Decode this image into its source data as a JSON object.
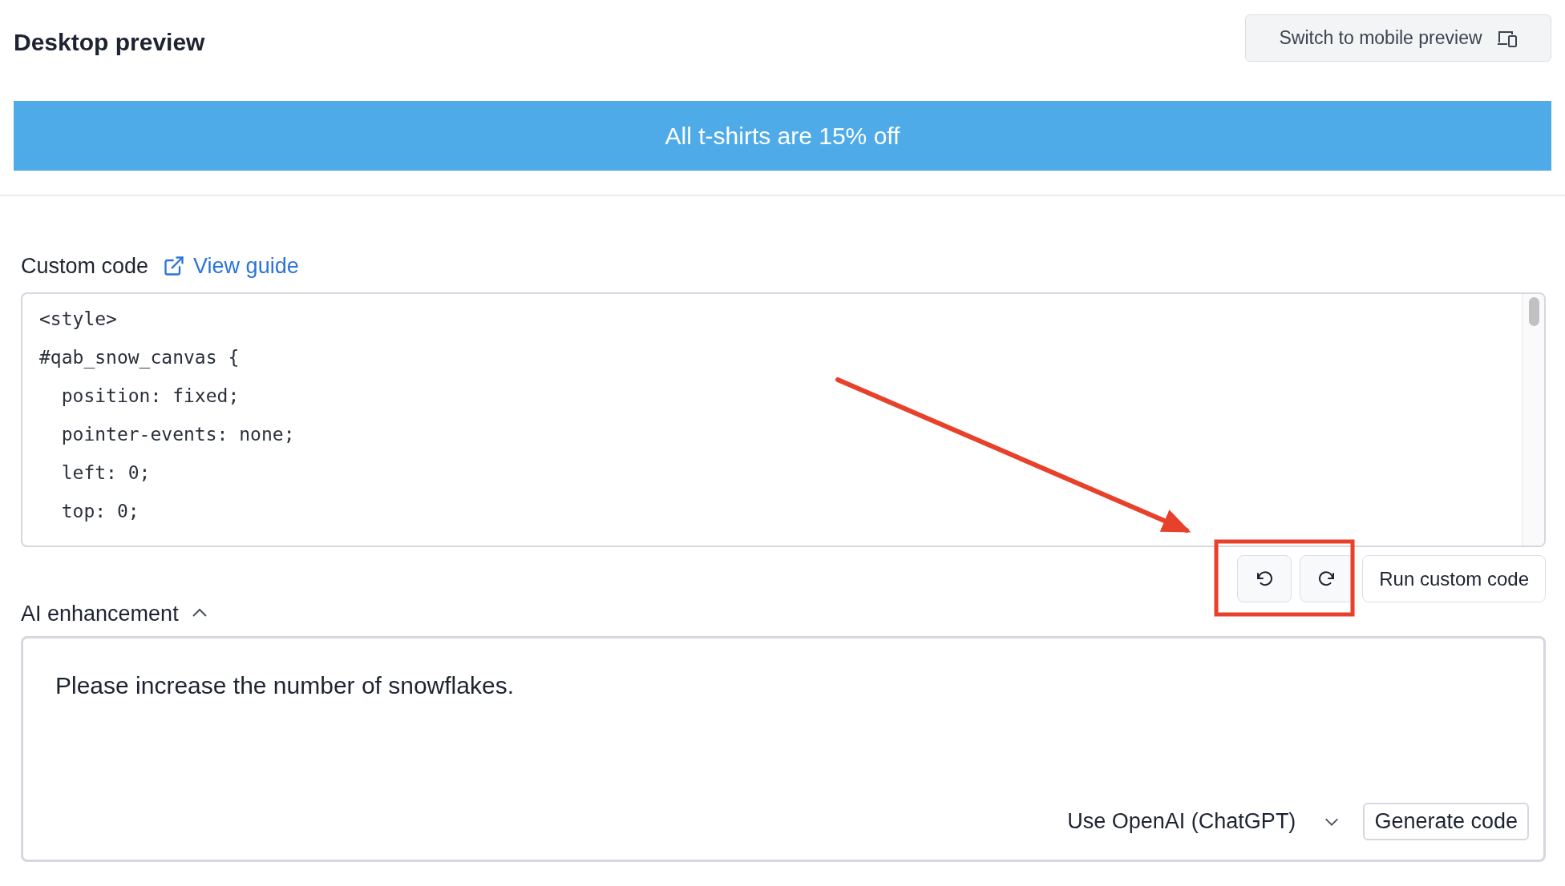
{
  "header": {
    "title": "Desktop preview",
    "switch_button": "Switch to mobile preview"
  },
  "banner": {
    "text": "All t-shirts are 15% off"
  },
  "custom_code": {
    "label": "Custom code",
    "guide_link": "View guide",
    "lines": [
      "<style>",
      "#qab_snow_canvas {",
      "  position: fixed;",
      "  pointer-events: none;",
      "  left: 0;",
      "  top: 0;"
    ],
    "run_button": "Run custom code"
  },
  "ai_enhancement": {
    "label": "AI enhancement",
    "expanded": true,
    "prompt": "Please increase the number of snowflakes.",
    "model_select": "Use OpenAI (ChatGPT)",
    "generate_button": "Generate code"
  }
}
